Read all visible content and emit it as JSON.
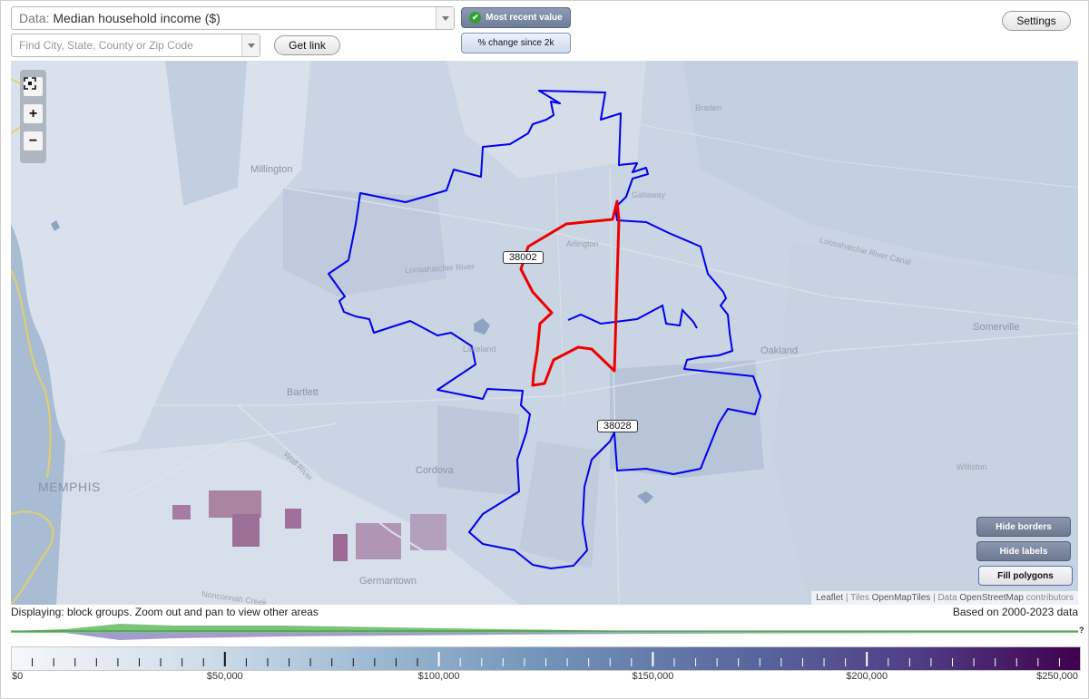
{
  "header": {
    "data_prefix": "Data:",
    "data_value": "Median household income ($)",
    "search_placeholder": "Find City, State, County or Zip Code",
    "get_link": "Get link",
    "settings": "Settings",
    "mode_active": "Most recent value",
    "mode_inactive": "% change since 2k"
  },
  "map": {
    "zoom_in": "+",
    "zoom_out": "−",
    "places": {
      "millington": "Millington",
      "braden": "Braden",
      "gallaway": "Gallaway",
      "arlington": "Arlington",
      "loosahatchie_river": "Loosahatchie River",
      "loosahatchie_canal": "Loosahatchie River Canal",
      "lakeland": "Lakeland",
      "oakland": "Oakland",
      "somerville": "Somerville",
      "bartlett": "Bartlett",
      "cordova": "Cordova",
      "williston": "Williston",
      "memphis": "MEMPHIS",
      "germantown": "Germantown",
      "nonconnah": "Nonconnah Creek",
      "wolf_river": "Wolf River"
    },
    "zip_labels": {
      "zip_a": "38002",
      "zip_b": "38028"
    },
    "buttons": {
      "hide_borders": "Hide borders",
      "hide_labels": "Hide labels",
      "fill_polygons": "Fill polygons"
    },
    "attribution": {
      "leaflet": "Leaflet",
      "sep1": " | Tiles ",
      "tiles": "OpenMapTiles",
      "sep2": " | Data ",
      "data": "OpenStreetMap",
      "tail": " contributors"
    },
    "colors": {
      "zip_a_border": "#ee0000",
      "zip_b_border": "#0000ee"
    }
  },
  "status": {
    "left": "Displaying: block groups. Zoom out and pan to view other areas",
    "right": "Based on 2000-2023 data"
  },
  "histogram_marker": "?",
  "legend": {
    "labels": [
      "$0",
      "$50,000",
      "$100,000",
      "$150,000",
      "$200,000",
      "$250,000"
    ],
    "min": 0,
    "max": 250000
  }
}
